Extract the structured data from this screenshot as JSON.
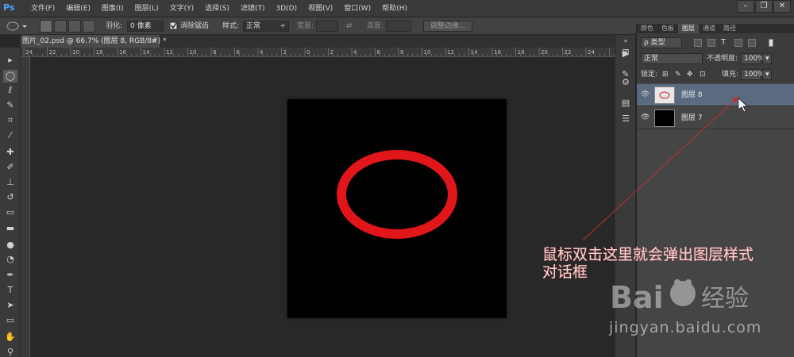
{
  "app": {
    "logo": "Ps"
  },
  "menu": [
    "文件(F)",
    "编辑(E)",
    "图像(I)",
    "图层(L)",
    "文字(Y)",
    "选择(S)",
    "滤镜(T)",
    "3D(D)",
    "视图(V)",
    "窗口(W)",
    "帮助(H)"
  ],
  "window_controls": {
    "minimize": "–",
    "restore": "❐",
    "close": "✕"
  },
  "options": {
    "feather_label": "羽化:",
    "feather_value": "0 像素",
    "antialias_label": "消除锯齿",
    "antialias_checked": true,
    "style_label": "样式:",
    "style_value": "正常",
    "width_label": "宽度:",
    "height_label": "高度:",
    "refine_edge_button": "调整边缘..."
  },
  "document": {
    "tab_title": "图片_02.psd @ 66.7% (图层 8, RGB/8#) *",
    "tab_title_shown": "图片_02.psd @ 66.7% (图层 8, RGB/8#) *",
    "close": "×"
  },
  "ruler_labels": [
    "24",
    "22",
    "20",
    "18",
    "16",
    "14",
    "12",
    "10",
    "8",
    "6",
    "4",
    "2",
    "0",
    "2",
    "4",
    "6",
    "8",
    "10",
    "12",
    "14",
    "16",
    "18",
    "20",
    "22",
    "24"
  ],
  "tools": [
    "move-tool",
    "elliptical-marquee-tool",
    "lasso-tool",
    "quick-selection-tool",
    "crop-tool",
    "eyedropper-tool",
    "healing-brush-tool",
    "brush-tool",
    "clone-stamp-tool",
    "history-brush-tool",
    "eraser-tool",
    "gradient-tool",
    "blur-tool",
    "dodge-tool",
    "pen-tool",
    "type-tool",
    "path-selection-tool",
    "rectangle-tool",
    "hand-tool",
    "zoom-tool"
  ],
  "panel": {
    "tabs": [
      "颜色",
      "色板",
      "图层",
      "通道",
      "路径"
    ],
    "active_tab": "图层",
    "filter_label": "ρ 类型",
    "blend_mode": "正常",
    "opacity_label": "不透明度:",
    "opacity_value": "100%",
    "lock_label": "锁定:",
    "fill_label": "填充:",
    "fill_value": "100%",
    "layers": [
      {
        "name": "图层 8",
        "selected": true
      },
      {
        "name": "图层 7",
        "selected": false
      }
    ]
  },
  "annotation": {
    "line1": "鼠标双击这里就会弹出图层样式",
    "line2": "对话框"
  },
  "watermark": {
    "brand": "Bai 经验",
    "url": "jingyan.baidu.com"
  },
  "colors": {
    "circle": "#e0161a",
    "annotation": "#ffd0d0",
    "selected_layer": "#5a6a80"
  }
}
